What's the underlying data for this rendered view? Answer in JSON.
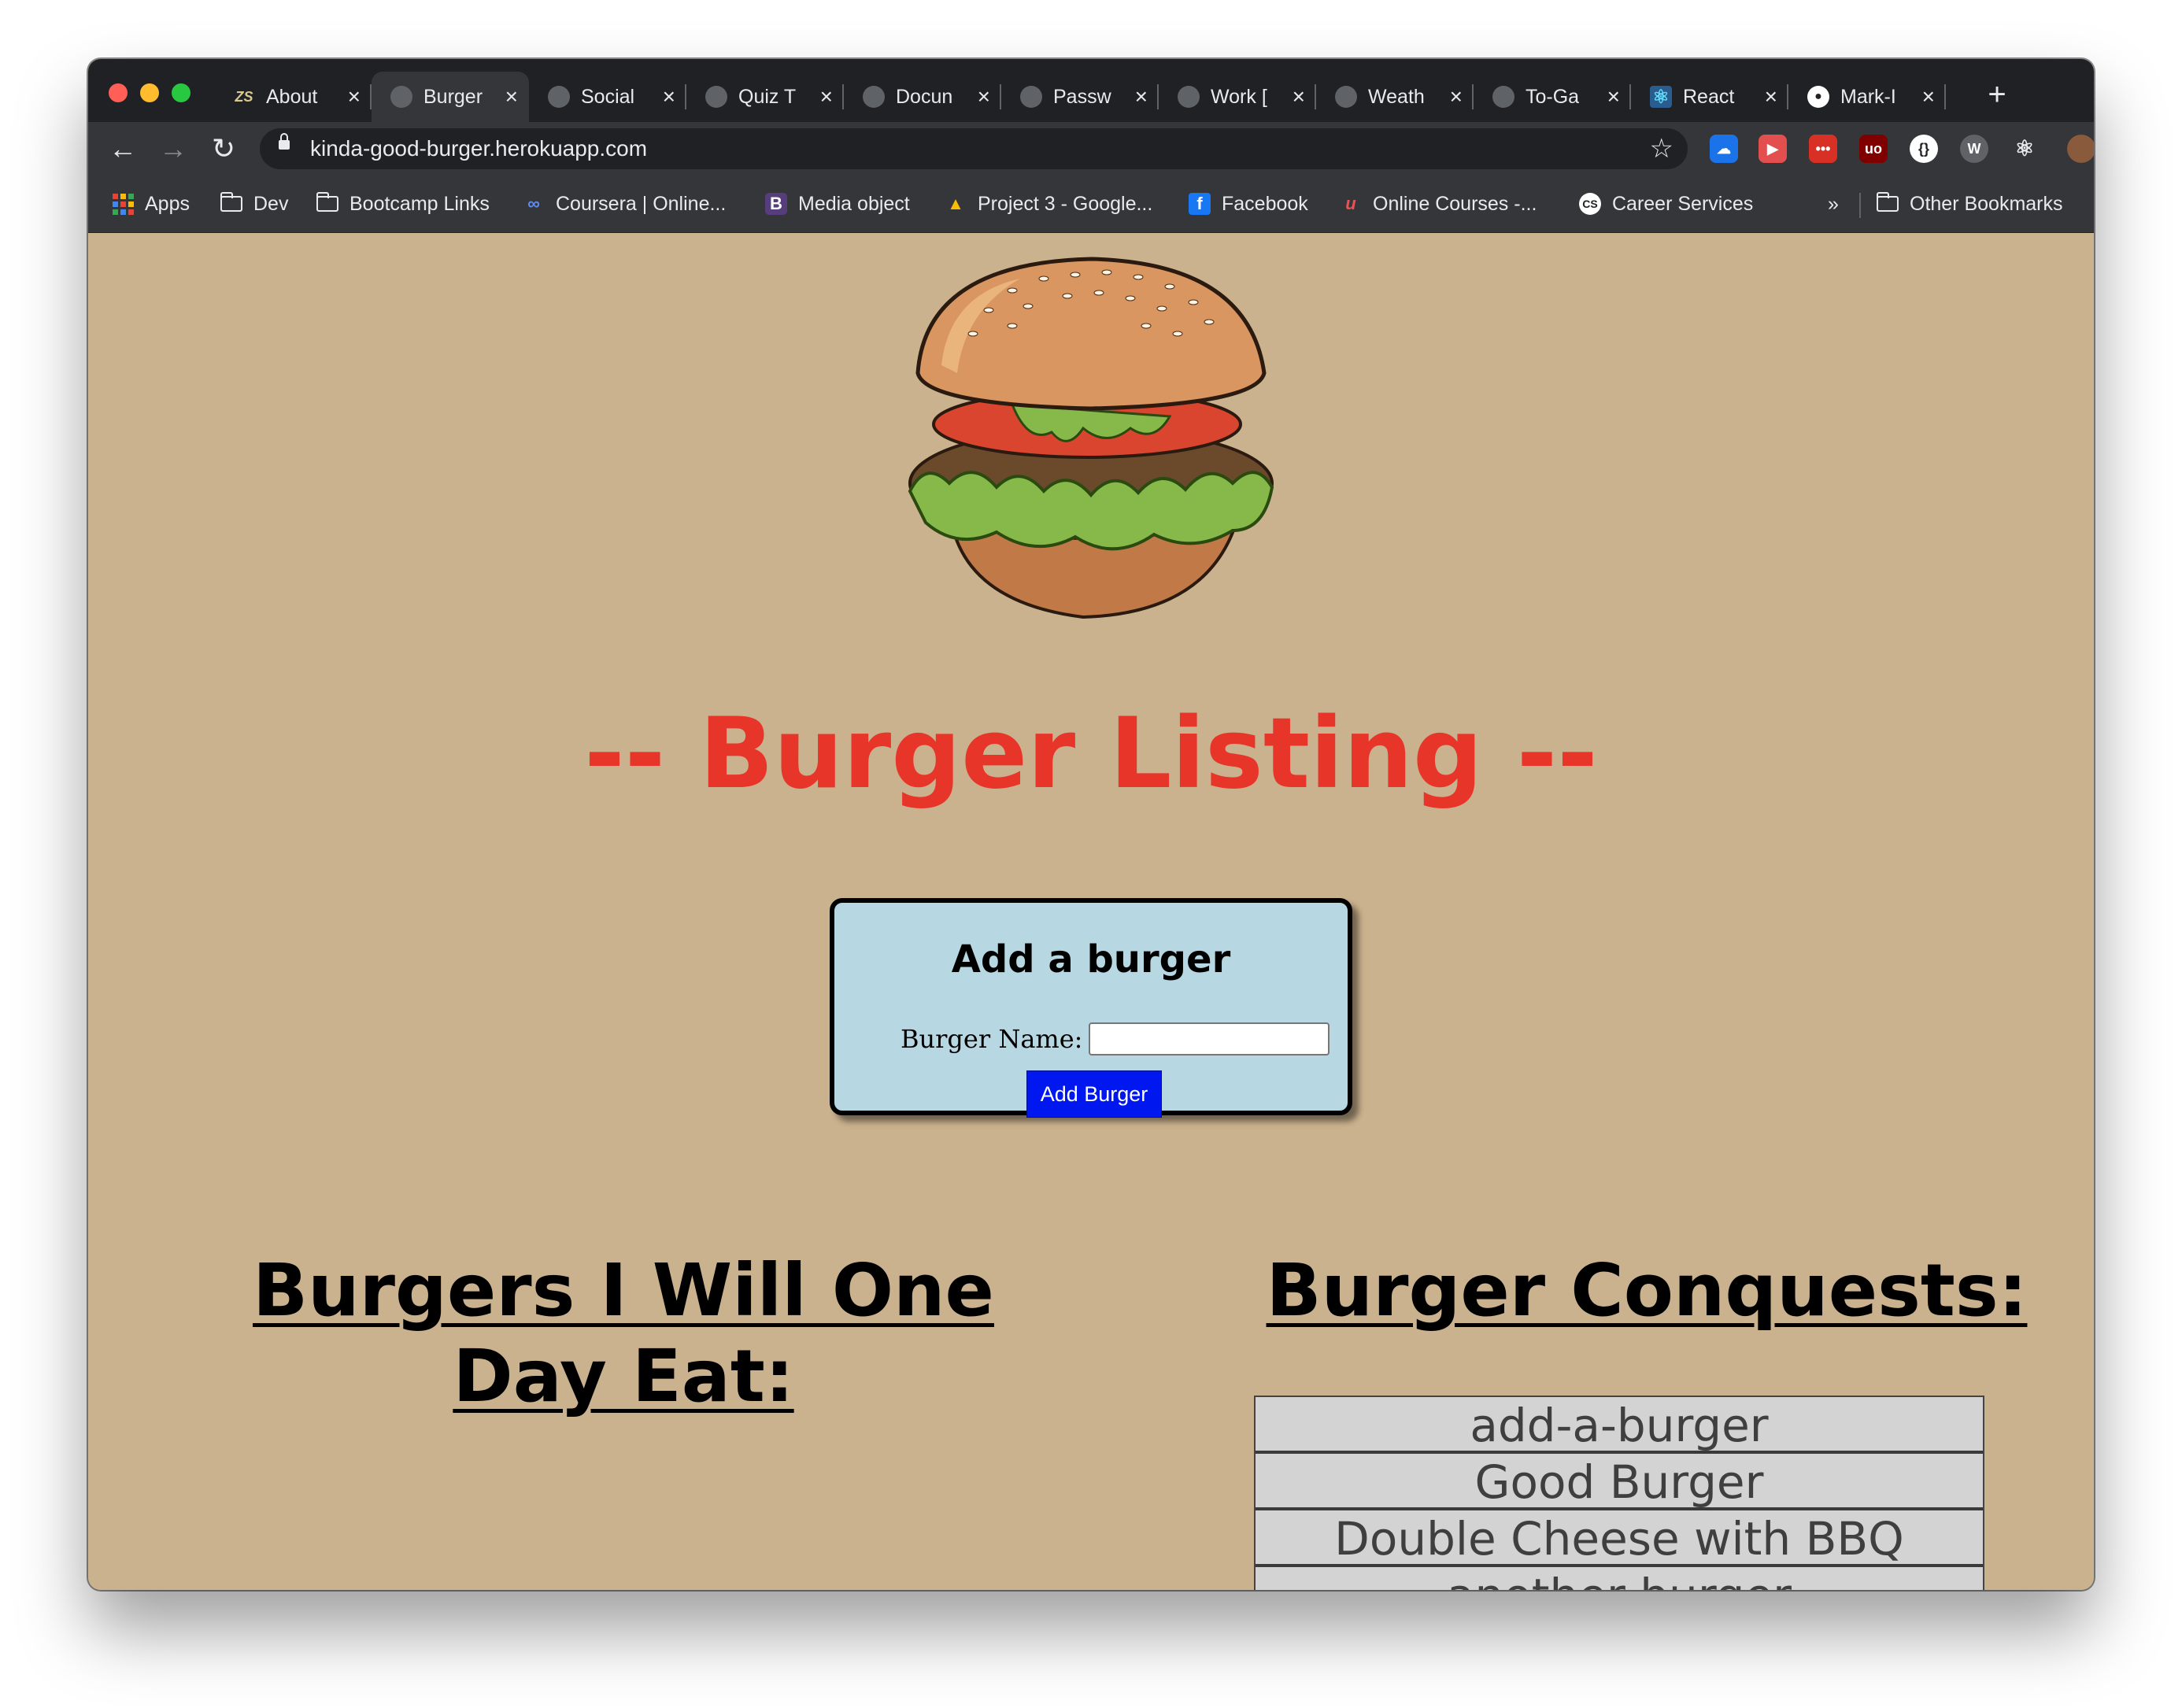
{
  "browser": {
    "tabs": [
      {
        "title": "About",
        "favicon": "zs-icon",
        "active": false
      },
      {
        "title": "Burger",
        "favicon": "globe-icon",
        "active": true
      },
      {
        "title": "Social",
        "favicon": "globe-icon",
        "active": false
      },
      {
        "title": "Quiz T",
        "favicon": "globe-icon",
        "active": false
      },
      {
        "title": "Docun",
        "favicon": "globe-icon",
        "active": false
      },
      {
        "title": "Passw",
        "favicon": "globe-icon",
        "active": false
      },
      {
        "title": "Work [",
        "favicon": "globe-icon",
        "active": false
      },
      {
        "title": "Weath",
        "favicon": "globe-icon",
        "active": false
      },
      {
        "title": "To-Ga",
        "favicon": "globe-icon",
        "active": false
      },
      {
        "title": "React",
        "favicon": "react-icon",
        "active": false
      },
      {
        "title": "Mark-I",
        "favicon": "github-icon",
        "active": false
      }
    ],
    "url": "kinda-good-burger.herokuapp.com",
    "bookmarks": [
      {
        "label": "Apps",
        "icon": "apps-grid-icon"
      },
      {
        "label": "Dev",
        "icon": "folder-icon"
      },
      {
        "label": "Bootcamp Links",
        "icon": "folder-icon"
      },
      {
        "label": "Coursera | Online...",
        "icon": "coursera-icon"
      },
      {
        "label": "Media object",
        "icon": "bootstrap-icon"
      },
      {
        "label": "Project 3 - Google...",
        "icon": "google-drive-icon"
      },
      {
        "label": "Facebook",
        "icon": "facebook-icon"
      },
      {
        "label": "Online Courses -...",
        "icon": "udemy-icon"
      },
      {
        "label": "Career Services",
        "icon": "cs-icon"
      }
    ],
    "overflow_label": "»",
    "other_bookmarks": "Other Bookmarks"
  },
  "page": {
    "title": "-- Burger Listing --",
    "form": {
      "title": "Add a burger",
      "label": "Burger Name:",
      "input_value": "",
      "button": "Add Burger"
    },
    "uneaten_heading": "Burgers I Will One Day Eat:",
    "uneaten": [],
    "eaten_heading": "Burger Conquests:",
    "eaten": [
      "add-a-burger",
      "Good Burger",
      "Double Cheese with BBQ",
      "another burger",
      ""
    ]
  },
  "colors": {
    "page_bg": "#cbb28e",
    "title_red": "#e8352a",
    "form_bg": "#b7d7e2",
    "button_blue": "#0017f0",
    "list_bg": "#d3d3d3"
  }
}
